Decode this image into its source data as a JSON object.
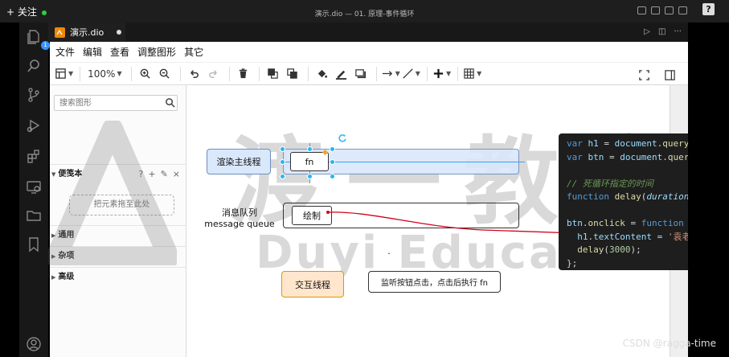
{
  "window": {
    "follow_label": "+ 关注",
    "title": "演示.dio — 01. 原理-事件循环"
  },
  "activity_bar": {
    "explorer_badge": "1",
    "icons": [
      "files-icon",
      "search-icon",
      "source-control-icon",
      "run-debug-icon",
      "extensions-icon",
      "remote-explorer-icon",
      "folder-icon",
      "bookmark-icon",
      "account-icon"
    ]
  },
  "editor_tab": {
    "label": "演示.dio",
    "icon": "drawio-icon"
  },
  "help_badge": "?",
  "menu": [
    "文件",
    "编辑",
    "查看",
    "调整图形",
    "其它"
  ],
  "toolbar": {
    "zoom": "100%",
    "icons": [
      "format-panel-icon",
      "zoom-in-icon",
      "zoom-out-icon",
      "undo-icon",
      "redo-icon",
      "delete-icon",
      "to-front-icon",
      "to-back-icon",
      "fill-color-icon",
      "line-color-icon",
      "shadow-icon",
      "connection-icon",
      "waypoints-icon",
      "insert-icon",
      "table-icon",
      "fullscreen-icon",
      "collapse-panel-icon"
    ]
  },
  "sidebar": {
    "search_placeholder": "搜索图形",
    "scratchpad_title": "便笺本",
    "scratchpad_tools": [
      "?",
      "+",
      "✎",
      "×"
    ],
    "dropzone_text": "把元素拖至此处",
    "sections": [
      "通用",
      "杂项",
      "高级"
    ]
  },
  "diagram": {
    "render_thread_label": "渲染主线程",
    "fn_block": "fn",
    "queue_label_line1": "消息队列",
    "queue_label_line2": "message queue",
    "draw_block": "绘制",
    "interaction_label": "交互线程",
    "listener_note": "监听按钮点击，点击后执行 fn",
    "dot": "."
  },
  "watermark": {
    "large_text": "渡一教育",
    "latin_text": "Duyi Educat"
  },
  "code_lines": [
    "var h1 = document.query",
    "var btn = document.quer",
    "",
    "// 死循环指定的时间",
    "function delay(duration",
    "",
    "btn.onclick = function",
    "  h1.textContent = '袁老",
    "  delay(3000);",
    "};"
  ],
  "credit": "CSDN @ragga-time",
  "colors": {
    "blue_fill": "#dae8fc",
    "blue_stroke": "#6c8ebf",
    "orange_fill": "#ffe6cc",
    "orange_stroke": "#d79b00",
    "selection": "#29b6f2",
    "arrow": "#d0021b"
  }
}
